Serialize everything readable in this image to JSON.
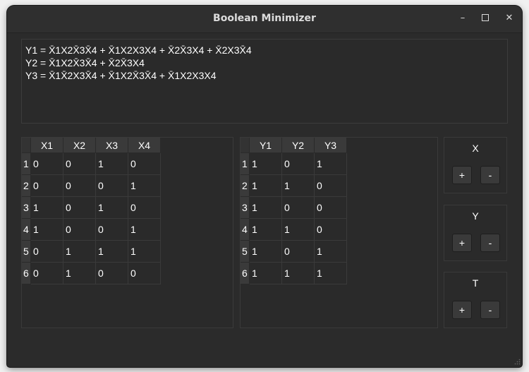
{
  "window": {
    "title": "Boolean Minimizer",
    "minimize": "–",
    "close": "✕"
  },
  "expressions": [
    "Y1 = X̄1X2X̄3X̄4 + X̄1X2X3X4 + X̄2X̄3X4 + X̄2X3X̄4",
    "Y2 = X̄1X2X̄3X̄4 + X̄2X̄3X4",
    "Y3 = X̄1X̄2X3X̄4 + X̄1X2X̄3X̄4 + X̄1X2X3X4"
  ],
  "inputs_table": {
    "columns": [
      "X1",
      "X2",
      "X3",
      "X4"
    ],
    "rows": [
      {
        "index": "1",
        "cells": [
          "0",
          "0",
          "1",
          "0"
        ]
      },
      {
        "index": "2",
        "cells": [
          "0",
          "0",
          "0",
          "1"
        ]
      },
      {
        "index": "3",
        "cells": [
          "1",
          "0",
          "1",
          "0"
        ]
      },
      {
        "index": "4",
        "cells": [
          "1",
          "0",
          "0",
          "1"
        ]
      },
      {
        "index": "5",
        "cells": [
          "0",
          "1",
          "1",
          "1"
        ]
      },
      {
        "index": "6",
        "cells": [
          "0",
          "1",
          "0",
          "0"
        ]
      }
    ]
  },
  "outputs_table": {
    "columns": [
      "Y1",
      "Y2",
      "Y3"
    ],
    "rows": [
      {
        "index": "1",
        "cells": [
          "1",
          "0",
          "1"
        ]
      },
      {
        "index": "2",
        "cells": [
          "1",
          "1",
          "0"
        ]
      },
      {
        "index": "3",
        "cells": [
          "1",
          "0",
          "0"
        ]
      },
      {
        "index": "4",
        "cells": [
          "1",
          "1",
          "0"
        ]
      },
      {
        "index": "5",
        "cells": [
          "1",
          "0",
          "1"
        ]
      },
      {
        "index": "6",
        "cells": [
          "1",
          "1",
          "1"
        ]
      }
    ]
  },
  "controls": [
    {
      "label": "X",
      "plus": "+",
      "minus": "-"
    },
    {
      "label": "Y",
      "plus": "+",
      "minus": "-"
    },
    {
      "label": "T",
      "plus": "+",
      "minus": "-"
    }
  ]
}
